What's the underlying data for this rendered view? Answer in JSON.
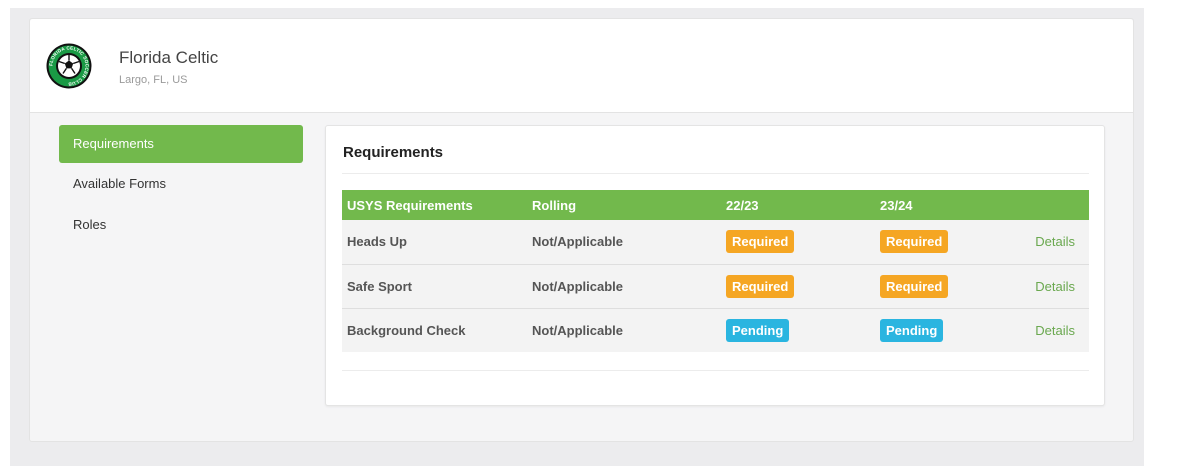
{
  "club": {
    "name": "Florida Celtic",
    "location": "Largo, FL, US",
    "logo_text": "FLORIDA CELTIC SOCCER CLUB",
    "logo_color": "#1a9a45"
  },
  "sidebar": {
    "items": [
      {
        "label": "Requirements",
        "active": true
      },
      {
        "label": "Available Forms",
        "active": false
      },
      {
        "label": "Roles",
        "active": false
      }
    ]
  },
  "panel": {
    "title": "Requirements",
    "table": {
      "headers": [
        "USYS Requirements",
        "Rolling",
        "22/23",
        "23/24",
        ""
      ],
      "rows": [
        {
          "name": "Heads Up",
          "rolling": "Not/Applicable",
          "s2223": "Required",
          "s2324": "Required",
          "action": "Details"
        },
        {
          "name": "Safe Sport",
          "rolling": "Not/Applicable",
          "s2223": "Required",
          "s2324": "Required",
          "action": "Details"
        },
        {
          "name": "Background Check",
          "rolling": "Not/Applicable",
          "s2223": "Pending",
          "s2324": "Pending",
          "action": "Details"
        }
      ]
    }
  },
  "colors": {
    "accent_green": "#72b94c",
    "required_orange": "#f5a623",
    "pending_blue": "#2ab5e0"
  }
}
